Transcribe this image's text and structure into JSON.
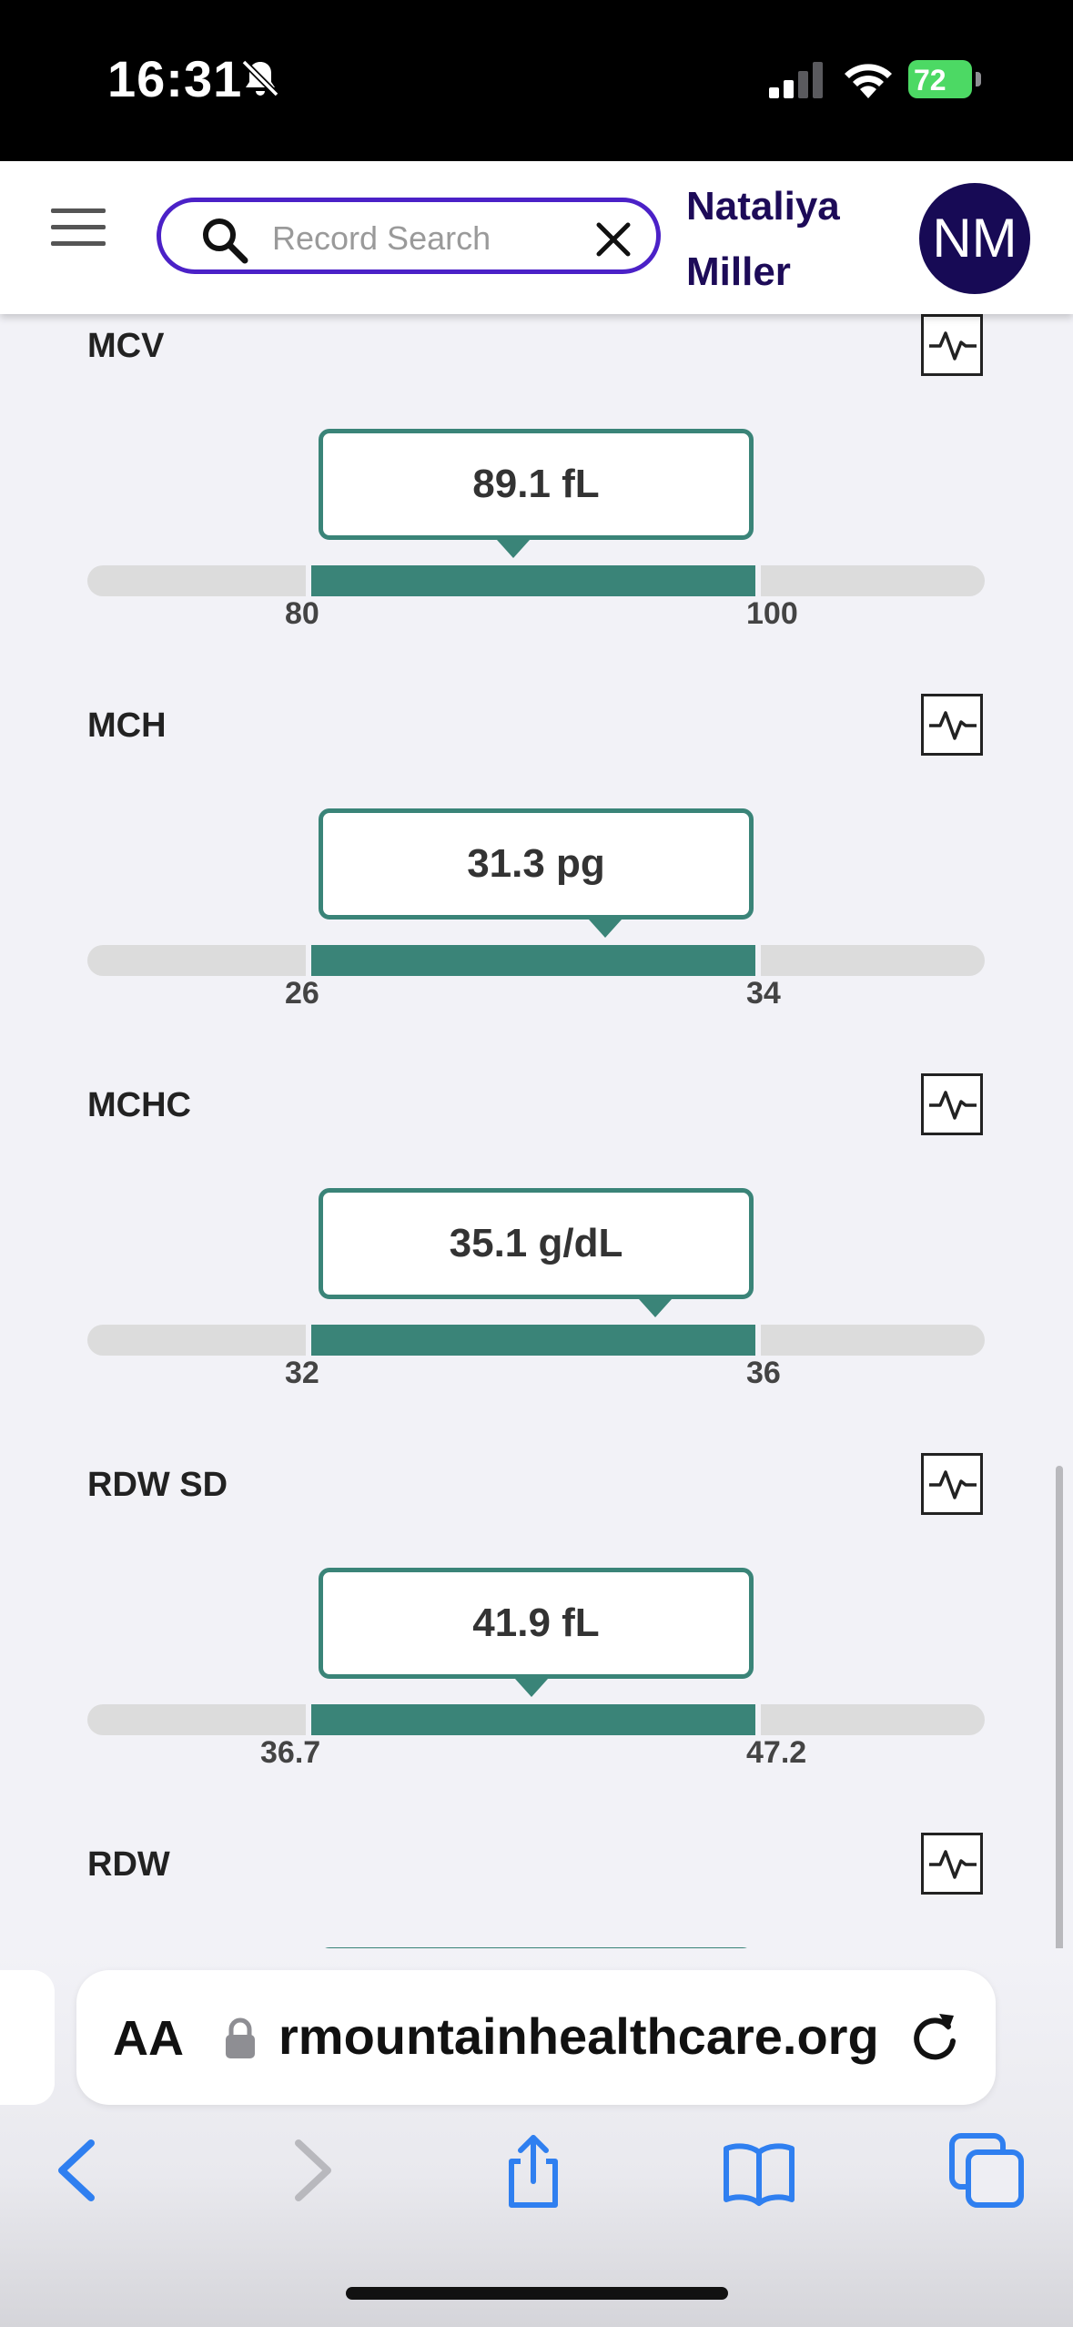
{
  "status_bar": {
    "time": "16:31",
    "battery": "72"
  },
  "header": {
    "search_placeholder": "Record Search",
    "user_first_name": "Nataliya",
    "user_last_name": "Miller",
    "avatar_initials": "NM"
  },
  "results": [
    {
      "name": "MCV",
      "value": "89.1 fL",
      "low": "80",
      "high": "100",
      "numeric_value": 89.1
    },
    {
      "name": "MCH",
      "value": "31.3 pg",
      "low": "26",
      "high": "34",
      "numeric_value": 31.3
    },
    {
      "name": "MCHC",
      "value": "35.1 g/dL",
      "low": "32",
      "high": "36",
      "numeric_value": 35.1
    },
    {
      "name": "RDW SD",
      "value": "41.9 fL",
      "low": "36.7",
      "high": "47.2",
      "numeric_value": 41.9
    },
    {
      "name": "RDW"
    }
  ],
  "browser": {
    "aa_label": "AA",
    "url": "rmountainhealthcare.org"
  },
  "colors": {
    "accent": "#4b21c7",
    "normal_range": "#3a8478",
    "avatar": "#170a55",
    "name_text": "#1d0b58"
  }
}
